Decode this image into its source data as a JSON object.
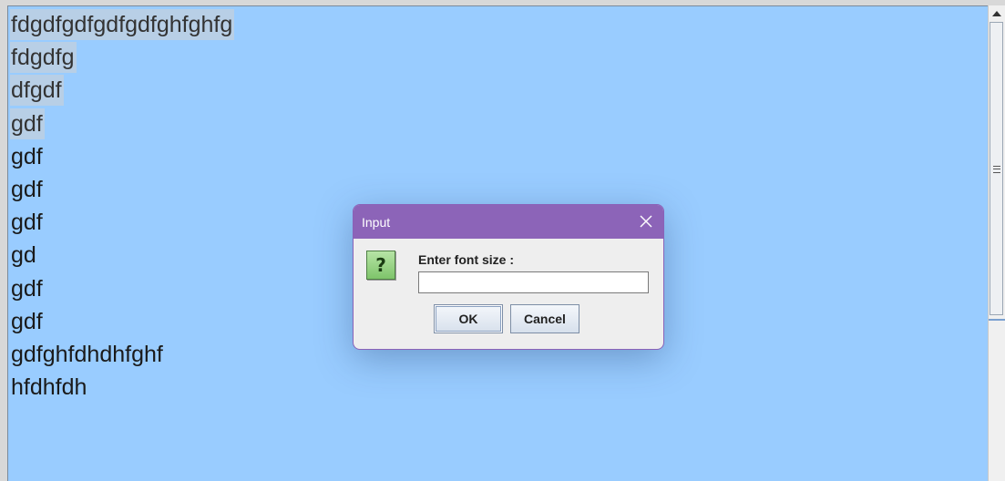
{
  "editor": {
    "lines": [
      {
        "text": "fdgdfgdfgdfgdfghfghfg",
        "selected": true
      },
      {
        "text": "fdgdfg",
        "selected": true
      },
      {
        "text": "dfgdf",
        "selected": true
      },
      {
        "text": "gdf",
        "selected": true
      },
      {
        "text": "gdf",
        "selected": false
      },
      {
        "text": "gdf",
        "selected": false
      },
      {
        "text": "gdf",
        "selected": false
      },
      {
        "text": "gd",
        "selected": false
      },
      {
        "text": "gdf",
        "selected": false
      },
      {
        "text": "gdf",
        "selected": false
      },
      {
        "text": "gdfghfdhdhfghf",
        "selected": false
      },
      {
        "text": "hfdhfdh",
        "selected": false
      }
    ],
    "background_color": "#99ccff",
    "selection_color": "#b8cfe6"
  },
  "dialog": {
    "title": "Input",
    "icon": "question-icon",
    "prompt": "Enter font size :",
    "input_value": "",
    "ok_label": "OK",
    "cancel_label": "Cancel",
    "titlebar_color": "#8c64b8"
  }
}
